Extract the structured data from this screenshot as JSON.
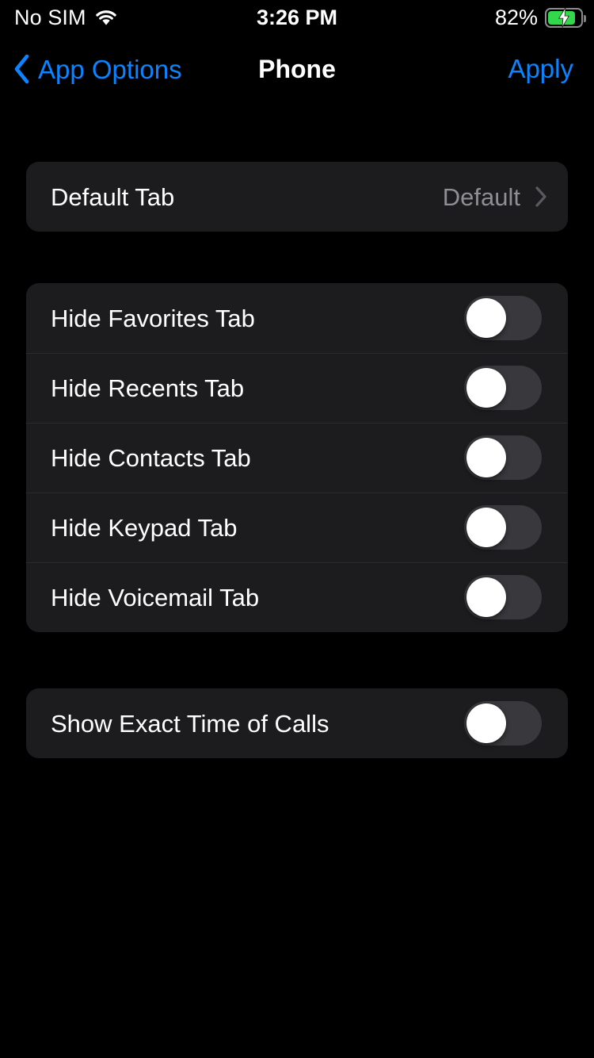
{
  "status_bar": {
    "carrier": "No SIM",
    "wifi_icon": "wifi-icon",
    "time": "3:26 PM",
    "battery_percent": "82%",
    "battery_icon": "battery-charging-icon",
    "battery_color": "#32D74B"
  },
  "nav_bar": {
    "back_icon": "chevron-left-icon",
    "back_label": "App Options",
    "title": "Phone",
    "action_label": "Apply",
    "accent_color": "#0A84FF"
  },
  "groups": [
    {
      "id": "default-tab",
      "rows": [
        {
          "label": "Default Tab",
          "value": "Default",
          "type": "disclosure",
          "disclosure_icon": "chevron-right-icon"
        }
      ]
    },
    {
      "id": "hide-tabs",
      "rows": [
        {
          "label": "Hide Favorites Tab",
          "type": "toggle",
          "on": false
        },
        {
          "label": "Hide Recents Tab",
          "type": "toggle",
          "on": false
        },
        {
          "label": "Hide Contacts Tab",
          "type": "toggle",
          "on": false
        },
        {
          "label": "Hide Keypad Tab",
          "type": "toggle",
          "on": false
        },
        {
          "label": "Hide Voicemail Tab",
          "type": "toggle",
          "on": false
        }
      ]
    },
    {
      "id": "exact-time",
      "rows": [
        {
          "label": "Show Exact Time of Calls",
          "type": "toggle",
          "on": false
        }
      ]
    }
  ],
  "theme": {
    "background": "#000000",
    "card_background": "#1C1C1E",
    "separator": "#2B2B2D",
    "primary_text": "#FFFFFF",
    "secondary_text": "#8E8E93",
    "toggle_off_track": "#39393D",
    "toggle_on_track": "#32D74B",
    "toggle_knob": "#FFFFFF"
  }
}
